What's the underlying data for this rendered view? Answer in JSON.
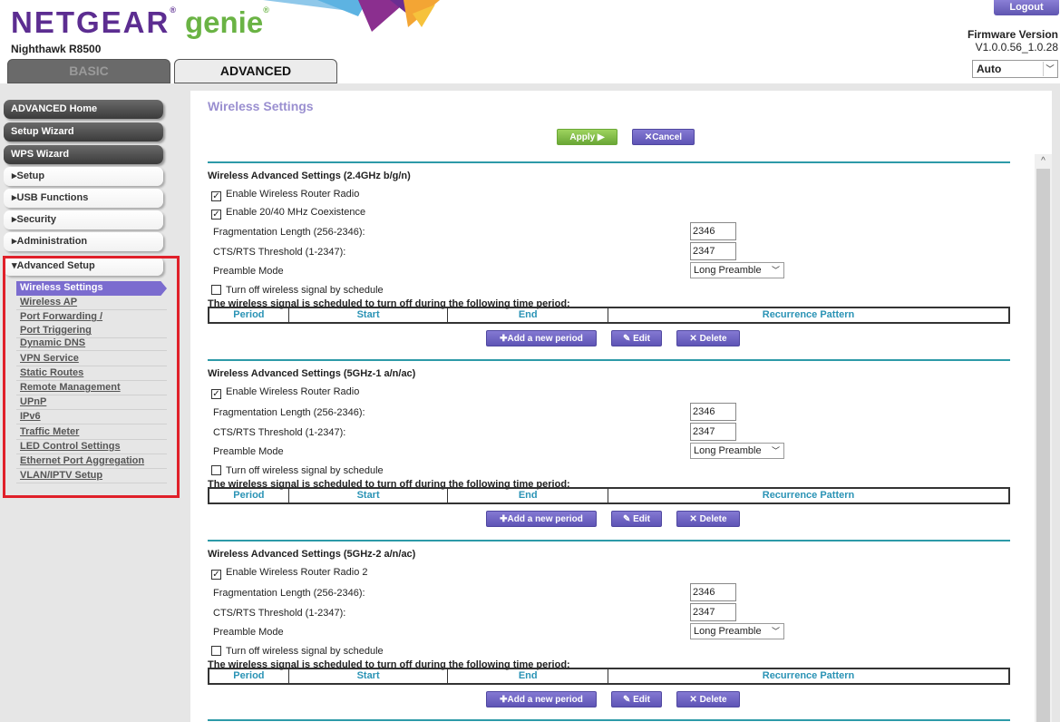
{
  "header": {
    "brand": "NETGEAR",
    "brand_sub": "genie",
    "model": "Nighthawk R8500",
    "logout": "Logout",
    "firmware_label": "Firmware Version",
    "firmware_version": "V1.0.0.56_1.0.28",
    "language": "Auto"
  },
  "tabs": [
    {
      "label": "BASIC",
      "active": false
    },
    {
      "label": "ADVANCED",
      "active": true
    }
  ],
  "sidebar": {
    "dark_items": [
      "ADVANCED Home",
      "Setup Wizard",
      "WPS Wizard"
    ],
    "light_items": [
      "Setup",
      "USB Functions",
      "Security",
      "Administration",
      "Advanced Setup"
    ],
    "expanded": "Advanced Setup",
    "sub_items": [
      "Wireless Settings",
      "Wireless AP",
      "Port Forwarding / Port Triggering",
      "Dynamic DNS",
      "VPN Service",
      "Static Routes",
      "Remote Management",
      "UPnP",
      "IPv6",
      "Traffic Meter",
      "LED Control Settings",
      "Ethernet Port Aggregation",
      "VLAN/IPTV Setup"
    ],
    "active_sub": "Wireless Settings"
  },
  "page": {
    "title": "Wireless Settings",
    "apply": "Apply ▶",
    "cancel": "✕Cancel"
  },
  "colors": {
    "accent": "#7b6ccf",
    "apply": "#6aa736",
    "divider": "#2d9aa8",
    "highlight": "#e0202a"
  },
  "labels": {
    "frag": "Fragmentation Length (256-2346):",
    "cts": "CTS/RTS Threshold (1-2347):",
    "preamble": "Preamble Mode",
    "schedule_cb": "Turn off wireless signal by schedule",
    "schedule_note": "The wireless signal is scheduled to turn off during the following time period:",
    "columns": [
      "Period",
      "Start",
      "End",
      "Recurrence Pattern"
    ],
    "add": "✚Add a new period",
    "edit": "✎ Edit",
    "delete": "✕ Delete"
  },
  "sections": [
    {
      "title": "Wireless Advanced Settings (2.4GHz b/g/n)",
      "checks": [
        {
          "label": "Enable Wireless Router Radio",
          "checked": true
        },
        {
          "label": "Enable 20/40 MHz Coexistence",
          "checked": true
        }
      ],
      "frag": "2346",
      "cts": "2347",
      "preamble": "Long Preamble",
      "schedule": false
    },
    {
      "title": "Wireless Advanced Settings (5GHz-1 a/n/ac)",
      "checks": [
        {
          "label": "Enable Wireless Router Radio",
          "checked": true
        }
      ],
      "frag": "2346",
      "cts": "2347",
      "preamble": "Long Preamble",
      "schedule": false
    },
    {
      "title": "Wireless Advanced Settings (5GHz-2 a/n/ac)",
      "checks": [
        {
          "label": "Enable Wireless Router Radio 2",
          "checked": true
        }
      ],
      "frag": "2346",
      "cts": "2347",
      "preamble": "Long Preamble",
      "schedule": false
    }
  ]
}
